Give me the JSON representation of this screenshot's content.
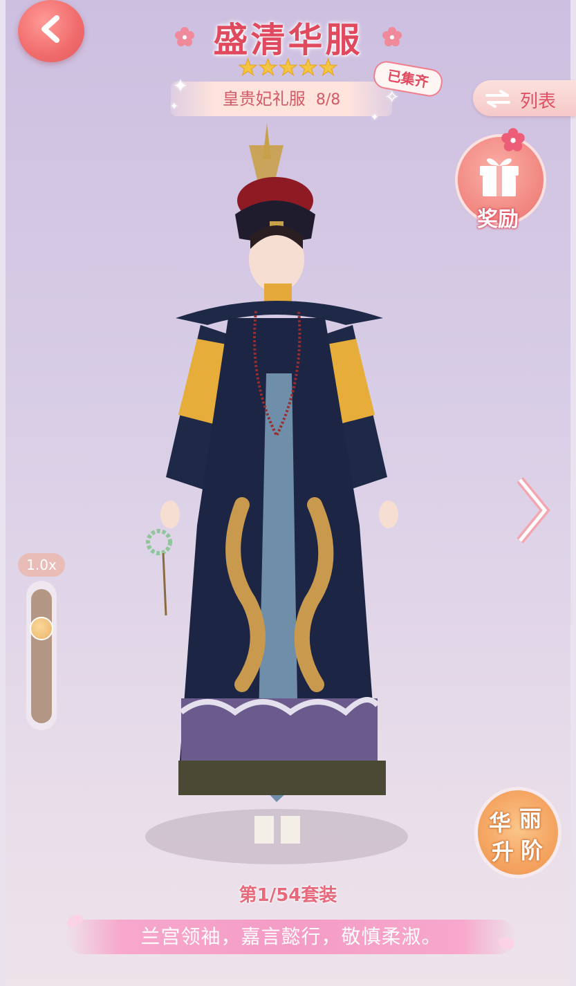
{
  "header": {
    "title": "盛清华服",
    "stars": 5,
    "suit_name": "皇贵妃礼服",
    "suit_progress": "8/8",
    "collected_badge": "已集齐"
  },
  "nav": {
    "back_icon": "chevron-left-icon",
    "list_label": "列表",
    "reward_label": "奖励",
    "next_icon": "chevron-right-icon"
  },
  "zoom": {
    "label": "1.0x",
    "level": 0.25
  },
  "upgrade": {
    "chars": [
      "华",
      "丽",
      "升",
      "阶"
    ]
  },
  "footer": {
    "suit_count": "第1/54套装",
    "motto": "兰宫领袖，嘉言懿行，敬慎柔淑。"
  },
  "colors": {
    "accent": "#e04a5f",
    "background": "#d8cde6",
    "gold": "#f4a25e"
  }
}
